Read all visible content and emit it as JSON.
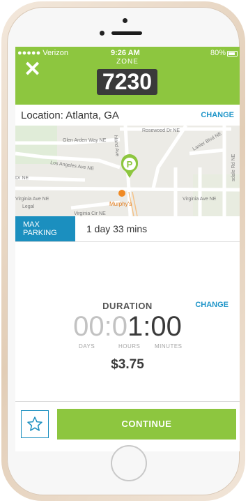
{
  "status_bar": {
    "carrier": "●●●●● Verizon",
    "time": "9:26 AM",
    "battery": "80%"
  },
  "header": {
    "zone_label": "ZONE",
    "zone_number": "7230"
  },
  "location": {
    "text": "Location: Atlanta, GA",
    "change_label": "CHANGE"
  },
  "map": {
    "streets": [
      "Rosewood Dr NE",
      "Glen Arden Way NE",
      "Lanier Blvd NE",
      "Los Angeles Ave NE",
      "Dr NE",
      "Virginia Ave NE",
      "Virginia Ave NE",
      "Legal",
      "Virginia Cir NE",
      "Murphy's",
      "hland Ave",
      "sdale Rd NE"
    ],
    "pin_letter": "P"
  },
  "max_parking": {
    "label_line1": "MAX",
    "label_line2": "PARKING",
    "value": "1 day 33 mins"
  },
  "duration": {
    "label": "DURATION",
    "change_label": "CHANGE",
    "days": "00",
    "hours_first": "0",
    "hours_rest": "1",
    "minutes": "00",
    "days_label": "DAYS",
    "hours_label": "HOURS",
    "minutes_label": "MINUTES"
  },
  "price": "$3.75",
  "footer": {
    "continue_label": "CONTINUE"
  },
  "colors": {
    "accent_green": "#8dc63f",
    "accent_blue": "#1b8fbf"
  }
}
